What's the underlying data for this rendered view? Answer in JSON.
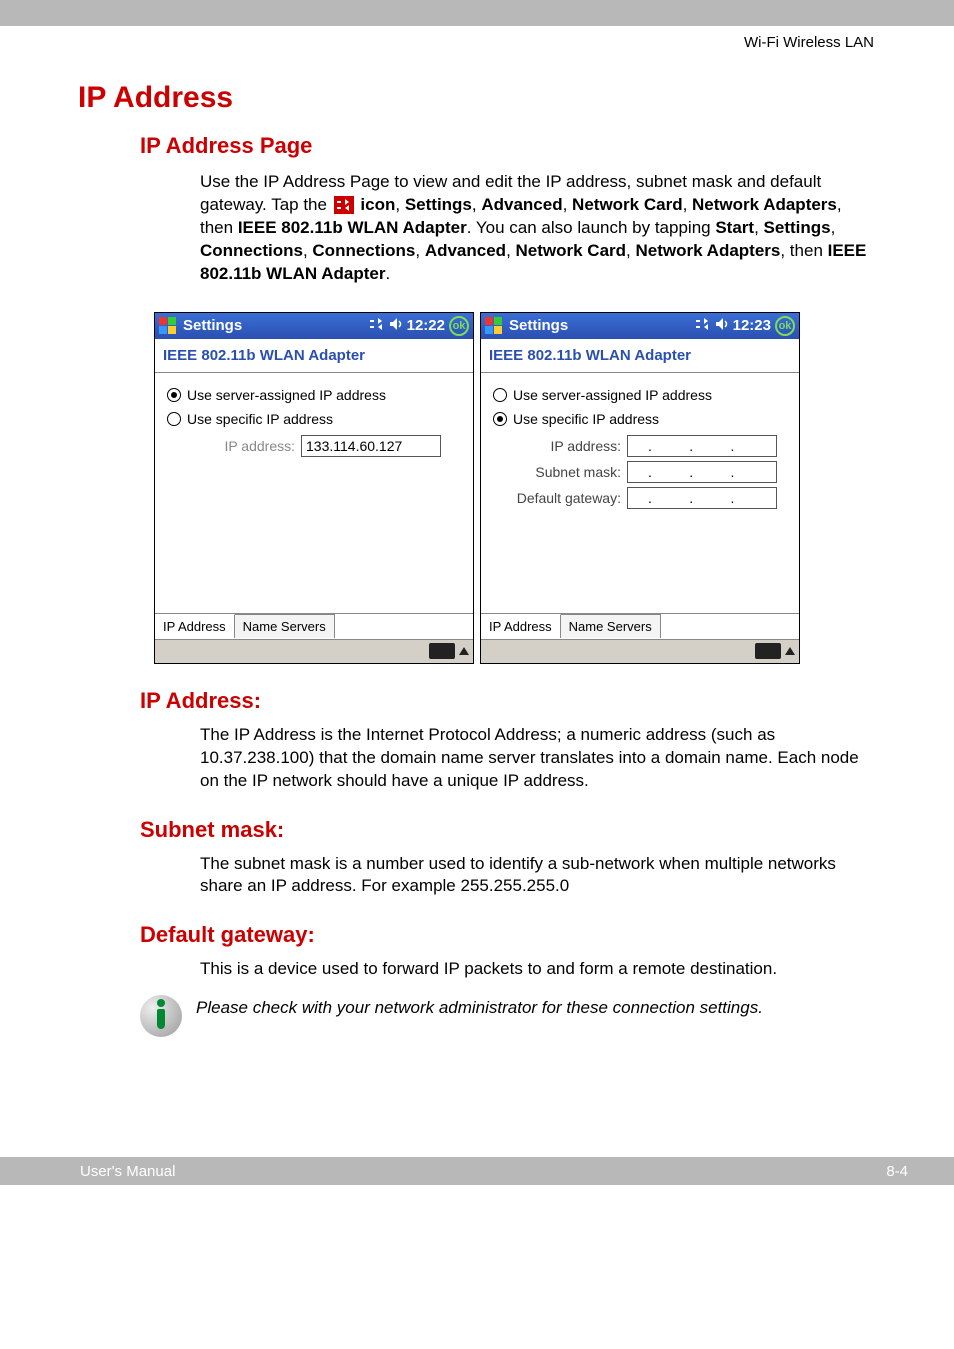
{
  "header": {
    "section": "Wi-Fi Wireless LAN"
  },
  "h1": "IP Address",
  "h2_page": "IP Address Page",
  "intro": {
    "part1": "Use the IP Address Page to view and edit the IP address, subnet mask and default gateway. Tap the ",
    "icon_label": " icon",
    "sep": ", ",
    "settings": "Settings",
    "advanced": "Advanced",
    "network_card": "Network Card",
    "network_adapters": "Network Adapters",
    "then": ", then ",
    "adapter": "IEEE 802.11b WLAN Adapter",
    "part2": ". You can also launch by tapping ",
    "start": "Start",
    "connections": "Connections",
    "period": "."
  },
  "screens": {
    "left": {
      "title": "Settings",
      "time": "12:22",
      "ok": "ok",
      "page_title": "IEEE 802.11b WLAN Adapter",
      "radio_server": "Use server-assigned IP address",
      "radio_specific": "Use specific IP address",
      "ip_label": "IP address:",
      "ip_value": "133.114.60.127",
      "tab_ip": "IP Address",
      "tab_ns": "Name Servers"
    },
    "right": {
      "title": "Settings",
      "time": "12:23",
      "ok": "ok",
      "page_title": "IEEE 802.11b WLAN Adapter",
      "radio_server": "Use server-assigned IP address",
      "radio_specific": "Use specific IP address",
      "ip_label": "IP address:",
      "subnet_label": "Subnet mask:",
      "gateway_label": "Default gateway:",
      "dots": ".      .      .",
      "tab_ip": "IP Address",
      "tab_ns": "Name Servers"
    }
  },
  "sections": {
    "ip": {
      "title": "IP Address:",
      "body": "The IP Address is the Internet Protocol Address; a numeric address (such as 10.37.238.100) that the domain name server translates into a domain name. Each node on the IP network should have a unique IP address."
    },
    "subnet": {
      "title": "Subnet mask:",
      "body": "The subnet mask is a number used to identify a sub-network when multiple networks share an IP address. For example 255.255.255.0"
    },
    "gateway": {
      "title": "Default gateway:",
      "body": "This is a device used to forward IP packets to and form a remote destination."
    }
  },
  "note": "Please check with your network administrator for these connection settings.",
  "footer": {
    "left": "User's Manual",
    "right": "8-4"
  }
}
